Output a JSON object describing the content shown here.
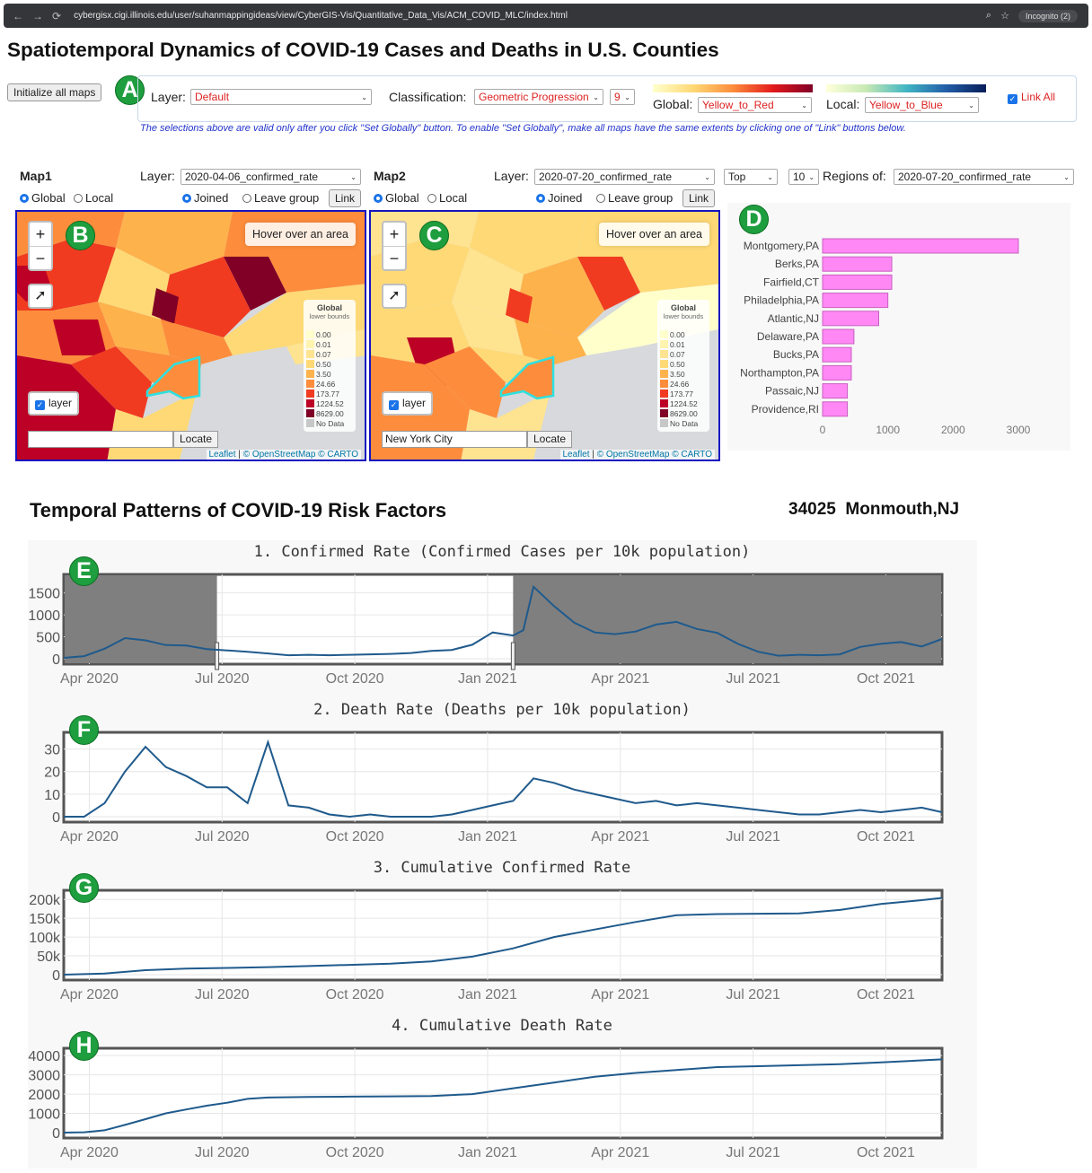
{
  "browser": {
    "url": "cybergisx.cigi.illinois.edu/user/suhanmappingideas/view/CyberGIS-Vis/Quantitative_Data_Vis/ACM_COVID_MLC/index.html",
    "incognito": "Incognito (2)"
  },
  "page_title": "Spatiotemporal Dynamics of COVID-19 Cases and Deaths in U.S. Counties",
  "controls": {
    "init_button": "Initialize all maps",
    "layer_label": "Layer:",
    "layer_value": "Default",
    "class_label": "Classification:",
    "class_value": "Geometric Progression",
    "class_count": "9",
    "global_label": "Global:",
    "global_value": "Yellow_to_Red",
    "local_label": "Local:",
    "local_value": "Yellow_to_Blue",
    "link_all": "Link All",
    "note": "The selections above are valid only after you click \"Set Globally\" button. To enable \"Set Globally\", make all maps have the same extents by clicking one of \"Link\" buttons below."
  },
  "badges": {
    "a": "A",
    "b": "B",
    "c": "C",
    "d": "D",
    "e": "E",
    "f": "F",
    "g": "G",
    "h": "H"
  },
  "map1": {
    "title": "Map1",
    "layer_label": "Layer:",
    "layer_value": "2020-04-06_confirmed_rate",
    "global": "Global",
    "local": "Local",
    "joined": "Joined",
    "leave": "Leave group",
    "link": "Link",
    "hover": "Hover over an area",
    "layer_toggle": "layer",
    "search_value": "",
    "locate": "Locate"
  },
  "map2": {
    "title": "Map2",
    "layer_label": "Layer:",
    "layer_value": "2020-07-20_confirmed_rate",
    "global": "Global",
    "local": "Local",
    "joined": "Joined",
    "leave": "Leave group",
    "link": "Link",
    "hover": "Hover over an area",
    "layer_toggle": "layer",
    "search_value": "New York City",
    "locate": "Locate",
    "top_value": "Top",
    "top_n": "10",
    "regions_label": "Regions of:",
    "regions_value": "2020-07-20_confirmed_rate"
  },
  "legend": {
    "title": "Global",
    "subtitle": "lower bounds",
    "items": [
      "0.00",
      "0.01",
      "0.07",
      "0.50",
      "3.50",
      "24.66",
      "173.77",
      "1224.52",
      "8629.00",
      "No Data"
    ],
    "colors": [
      "#ffffcc",
      "#fff3b0",
      "#fee391",
      "#fed976",
      "#feb24c",
      "#fd8d3c",
      "#f03b20",
      "#bd0026",
      "#800026",
      "#c7c7c7"
    ]
  },
  "attribution": {
    "leaflet": "Leaflet",
    "osm": "© OpenStreetMap © CARTO"
  },
  "bar_chart": {
    "type": "bar",
    "categories": [
      "Montgomery,PA",
      "Berks,PA",
      "Fairfield,CT",
      "Philadelphia,PA",
      "Atlantic,NJ",
      "Delaware,PA",
      "Bucks,PA",
      "Northampton,PA",
      "Passaic,NJ",
      "Providence,RI"
    ],
    "values": [
      3000,
      1060,
      1060,
      1000,
      860,
      480,
      440,
      440,
      380,
      380
    ],
    "xticks": [
      "0",
      "1000",
      "2000",
      "3000"
    ],
    "xlim": [
      0,
      3250
    ],
    "color": "#ff88f5"
  },
  "section2_title": "Temporal Patterns of COVID-19 Risk Factors",
  "selected_county": {
    "fips": "34025",
    "name": "Monmouth,NJ"
  },
  "chart_data": [
    {
      "type": "line",
      "title": "1. Confirmed Rate (Confirmed Cases per 10k population)",
      "yticks": [
        "0",
        "500",
        "1000",
        "1500"
      ],
      "ylim": [
        0,
        1800
      ],
      "xticks": [
        "Apr 2020",
        "Jul 2020",
        "Oct 2020",
        "Jan 2021",
        "Apr 2021",
        "Jul 2021",
        "Oct 2021"
      ],
      "x_range_weeks": [
        0,
        86
      ],
      "x": [
        0,
        2,
        4,
        6,
        8,
        10,
        12,
        14,
        16,
        18,
        20,
        22,
        24,
        26,
        28,
        30,
        32,
        34,
        36,
        38,
        40,
        42,
        44,
        45,
        46,
        48,
        50,
        52,
        54,
        56,
        58,
        60,
        62,
        64,
        66,
        68,
        70,
        72,
        74,
        76,
        78,
        80,
        82,
        84,
        86
      ],
      "values": [
        20,
        60,
        230,
        470,
        420,
        310,
        300,
        220,
        190,
        160,
        120,
        80,
        90,
        80,
        90,
        100,
        110,
        130,
        180,
        200,
        320,
        600,
        530,
        650,
        1640,
        1200,
        820,
        600,
        560,
        620,
        780,
        840,
        680,
        590,
        340,
        160,
        70,
        90,
        80,
        100,
        270,
        340,
        380,
        280,
        450
      ],
      "brush_selection_weeks": [
        15,
        44
      ]
    },
    {
      "type": "line",
      "title": "2. Death Rate (Deaths per 10k population)",
      "yticks": [
        "0",
        "10",
        "20",
        "30"
      ],
      "ylim": [
        0,
        35
      ],
      "xticks": [
        "Apr 2020",
        "Jul 2020",
        "Oct 2020",
        "Jan 2021",
        "Apr 2021",
        "Jul 2021",
        "Oct 2021"
      ],
      "x_range_weeks": [
        0,
        86
      ],
      "x": [
        0,
        2,
        4,
        6,
        8,
        10,
        12,
        14,
        16,
        18,
        20,
        22,
        24,
        26,
        28,
        30,
        32,
        34,
        36,
        38,
        40,
        42,
        44,
        46,
        48,
        50,
        52,
        54,
        56,
        58,
        60,
        62,
        64,
        66,
        68,
        70,
        72,
        74,
        76,
        78,
        80,
        82,
        84,
        86
      ],
      "values": [
        0,
        0,
        6,
        20,
        31,
        22,
        18,
        13,
        13,
        6,
        33,
        5,
        4,
        1,
        0,
        1,
        0,
        0,
        0,
        1,
        3,
        5,
        7,
        17,
        15,
        12,
        10,
        8,
        6,
        7,
        5,
        6,
        5,
        4,
        3,
        2,
        1,
        1,
        2,
        3,
        2,
        3,
        4,
        2
      ]
    },
    {
      "type": "line",
      "title": "3. Cumulative Confirmed Rate",
      "yticks": [
        "0",
        "50k",
        "100k",
        "150k",
        "200k"
      ],
      "ylim": [
        0,
        210000
      ],
      "xticks": [
        "Apr 2020",
        "Jul 2020",
        "Oct 2020",
        "Jan 2021",
        "Apr 2021",
        "Jul 2021",
        "Oct 2021"
      ],
      "x_range_weeks": [
        0,
        86
      ],
      "x": [
        0,
        4,
        8,
        12,
        16,
        20,
        24,
        28,
        32,
        36,
        40,
        44,
        48,
        52,
        56,
        60,
        64,
        68,
        72,
        76,
        80,
        84,
        86
      ],
      "values": [
        0,
        3000,
        12000,
        16000,
        18000,
        20000,
        23000,
        26000,
        29000,
        35000,
        48000,
        70000,
        100000,
        120000,
        140000,
        158000,
        161000,
        162000,
        163000,
        172000,
        188000,
        198000,
        204000
      ]
    },
    {
      "type": "line",
      "title": "4. Cumulative Death Rate",
      "yticks": [
        "0",
        "1000",
        "2000",
        "3000",
        "4000"
      ],
      "ylim": [
        0,
        4100
      ],
      "xticks": [
        "Apr 2020",
        "Jul 2020",
        "Oct 2020",
        "Jan 2021",
        "Apr 2021",
        "Jul 2021",
        "Oct 2021"
      ],
      "x_range_weeks": [
        0,
        86
      ],
      "x": [
        0,
        2,
        4,
        6,
        8,
        10,
        12,
        14,
        16,
        18,
        20,
        24,
        28,
        32,
        36,
        40,
        44,
        48,
        52,
        56,
        60,
        64,
        68,
        72,
        76,
        80,
        84,
        86
      ],
      "values": [
        0,
        20,
        120,
        400,
        700,
        1000,
        1200,
        1400,
        1550,
        1750,
        1820,
        1850,
        1870,
        1880,
        1900,
        2000,
        2300,
        2600,
        2900,
        3100,
        3250,
        3400,
        3450,
        3500,
        3550,
        3650,
        3750,
        3800
      ]
    }
  ]
}
